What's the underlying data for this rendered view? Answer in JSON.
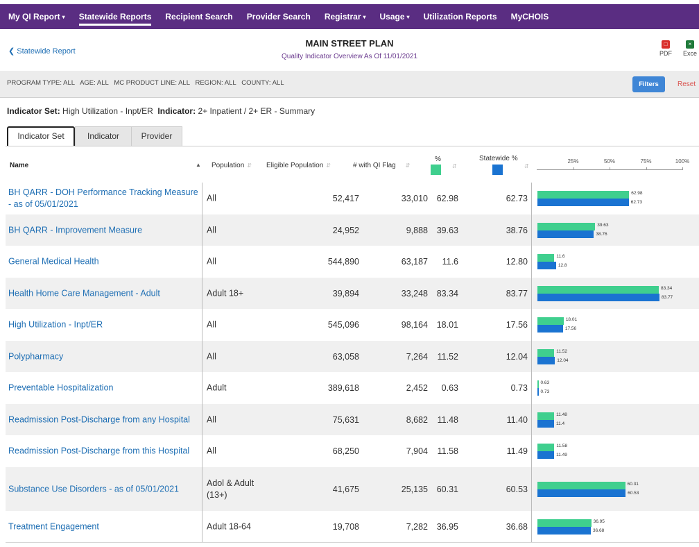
{
  "nav": {
    "items": [
      {
        "label": "My QI Report",
        "caret": "▾",
        "active": false
      },
      {
        "label": "Statewide Reports",
        "caret": "",
        "active": true
      },
      {
        "label": "Recipient Search",
        "caret": "",
        "active": false
      },
      {
        "label": "Provider Search",
        "caret": "",
        "active": false
      },
      {
        "label": "Registrar",
        "caret": "▾",
        "active": false
      },
      {
        "label": "Usage",
        "caret": "▾",
        "active": false
      },
      {
        "label": "Utilization Reports",
        "caret": "",
        "active": false
      },
      {
        "label": "MyCHOIS",
        "caret": "",
        "active": false
      }
    ]
  },
  "header": {
    "back_label": "Statewide Report",
    "title": "MAIN STREET PLAN",
    "subtitle": "Quality Indicator Overview As Of 11/01/2021",
    "pdf_label": "PDF",
    "excel_label": "Exce"
  },
  "filters": {
    "summary": "PROGRAM TYPE: ALL   AGE: ALL   MC PRODUCT LINE: ALL   REGION: ALL   COUNTY: ALL",
    "button_label": "Filters",
    "reset_label": "Reset"
  },
  "indicator": {
    "set_label": "Indicator Set",
    "set_value": "High Utilization - Inpt/ER",
    "ind_label": "Indicator",
    "ind_value": "2+ Inpatient / 2+ ER - Summary"
  },
  "tabs": [
    "Indicator Set",
    "Indicator",
    "Provider"
  ],
  "table": {
    "headers": {
      "name": "Name",
      "population": "Population",
      "eligible": "Eligible Population",
      "flag": "# with QI Flag",
      "pct": "%",
      "statewide": "Statewide %"
    },
    "axis_ticks": [
      "25%",
      "50%",
      "75%",
      "100%"
    ],
    "colors": {
      "percent": "#3fcf8e",
      "statewide": "#1a73d1"
    },
    "rows": [
      {
        "name": "BH QARR - DOH Performance Tracking Measure - as of 05/01/2021",
        "population": "All",
        "eligible": "52,417",
        "flag": "33,010",
        "pct": "62.98",
        "statewide": "62.73",
        "pct_val": 62.98,
        "sw_val": 62.73
      },
      {
        "name": "BH QARR - Improvement Measure",
        "population": "All",
        "eligible": "24,952",
        "flag": "9,888",
        "pct": "39.63",
        "statewide": "38.76",
        "pct_val": 39.63,
        "sw_val": 38.76
      },
      {
        "name": "General Medical Health",
        "population": "All",
        "eligible": "544,890",
        "flag": "63,187",
        "pct": "11.6",
        "statewide": "12.80",
        "pct_val": 11.6,
        "sw_val": 12.8
      },
      {
        "name": "Health Home Care Management - Adult",
        "population": "Adult 18+",
        "eligible": "39,894",
        "flag": "33,248",
        "pct": "83.34",
        "statewide": "83.77",
        "pct_val": 83.34,
        "sw_val": 83.77
      },
      {
        "name": "High Utilization - Inpt/ER",
        "population": "All",
        "eligible": "545,096",
        "flag": "98,164",
        "pct": "18.01",
        "statewide": "17.56",
        "pct_val": 18.01,
        "sw_val": 17.56
      },
      {
        "name": "Polypharmacy",
        "population": "All",
        "eligible": "63,058",
        "flag": "7,264",
        "pct": "11.52",
        "statewide": "12.04",
        "pct_val": 11.52,
        "sw_val": 12.04
      },
      {
        "name": "Preventable Hospitalization",
        "population": "Adult",
        "eligible": "389,618",
        "flag": "2,452",
        "pct": "0.63",
        "statewide": "0.73",
        "pct_val": 0.63,
        "sw_val": 0.73
      },
      {
        "name": "Readmission Post-Discharge from any Hospital",
        "population": "All",
        "eligible": "75,631",
        "flag": "8,682",
        "pct": "11.48",
        "statewide": "11.40",
        "pct_val": 11.48,
        "sw_val": 11.4
      },
      {
        "name": "Readmission Post-Discharge from this Hospital",
        "population": "All",
        "eligible": "68,250",
        "flag": "7,904",
        "pct": "11.58",
        "statewide": "11.49",
        "pct_val": 11.58,
        "sw_val": 11.49
      },
      {
        "name": "Substance Use Disorders - as of 05/01/2021",
        "population": "Adol & Adult (13+)",
        "eligible": "41,675",
        "flag": "25,135",
        "pct": "60.31",
        "statewide": "60.53",
        "pct_val": 60.31,
        "sw_val": 60.53
      },
      {
        "name": "Treatment Engagement",
        "population": "Adult 18-64",
        "eligible": "19,708",
        "flag": "7,282",
        "pct": "36.95",
        "statewide": "36.68",
        "pct_val": 36.95,
        "sw_val": 36.68
      }
    ]
  }
}
